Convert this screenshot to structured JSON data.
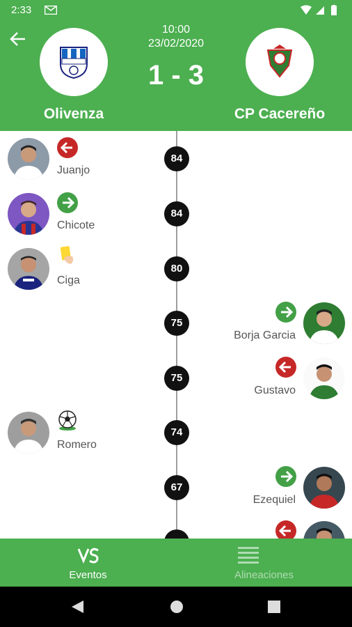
{
  "status_bar": {
    "time": "2:33"
  },
  "header": {
    "home_team": "Olivenza",
    "away_team": "CP Cacereño",
    "time": "10:00",
    "date": "23/02/2020",
    "score": "1 - 3"
  },
  "colors": {
    "primary": "#4caf50",
    "sub_out": "#c62828",
    "sub_in": "#43a047",
    "yellow_card": "#fdd835"
  },
  "events": [
    {
      "minute": "84",
      "side": "home",
      "type": "substitution-out",
      "player": "Juanjo"
    },
    {
      "minute": "84",
      "side": "home",
      "type": "substitution-in",
      "player": "Chicote"
    },
    {
      "minute": "80",
      "side": "home",
      "type": "yellow-card",
      "player": "Ciga"
    },
    {
      "minute": "75",
      "side": "away",
      "type": "substitution-in",
      "player": "Borja Garcia"
    },
    {
      "minute": "75",
      "side": "away",
      "type": "substitution-out",
      "player": "Gustavo"
    },
    {
      "minute": "74",
      "side": "home",
      "type": "goal",
      "player": "Romero"
    },
    {
      "minute": "67",
      "side": "away",
      "type": "substitution-in",
      "player": "Ezequiel"
    },
    {
      "minute": "",
      "side": "away",
      "type": "substitution-out",
      "player": ""
    }
  ],
  "tabs": [
    {
      "label": "Eventos",
      "icon": "vs-icon",
      "active": true
    },
    {
      "label": "Alineaciones",
      "icon": "lineup-icon",
      "active": false
    }
  ]
}
